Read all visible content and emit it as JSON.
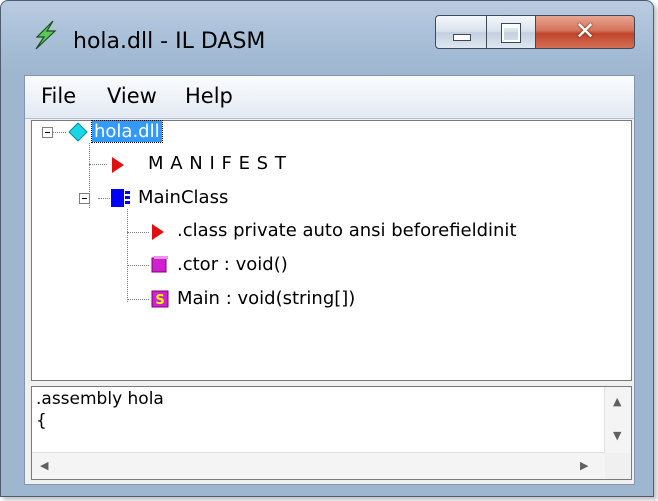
{
  "window": {
    "title": "hola.dll - IL DASM",
    "app_icon": "lightning-icon",
    "controls": [
      "minimize-icon",
      "maximize-icon",
      "close-icon"
    ]
  },
  "menu": {
    "items": [
      "File",
      "View",
      "Help"
    ]
  },
  "tree": {
    "root": {
      "label": "hola.dll",
      "icon": "assembly-diamond-icon",
      "selected": true
    },
    "manifest": {
      "label": "M A N I F E S T",
      "icon": "red-triangle-icon"
    },
    "mainclass": {
      "label": "MainClass",
      "icon": "class-icon"
    },
    "members": [
      {
        "label": ".class private auto ansi beforefieldinit",
        "icon": "red-triangle-icon"
      },
      {
        "label": ".ctor : void()",
        "icon": "method-icon"
      },
      {
        "label": "Main : void(string[])",
        "icon": "static-method-icon",
        "badge": "S"
      }
    ]
  },
  "detail": {
    "lines": [
      ".assembly hola",
      "{"
    ]
  },
  "colors": {
    "selection": "#3399ff",
    "assembly_icon": "#19d6e6",
    "triangle": "#e01010",
    "class_icon": "#0000ff",
    "method_icon": "#d020d0"
  }
}
